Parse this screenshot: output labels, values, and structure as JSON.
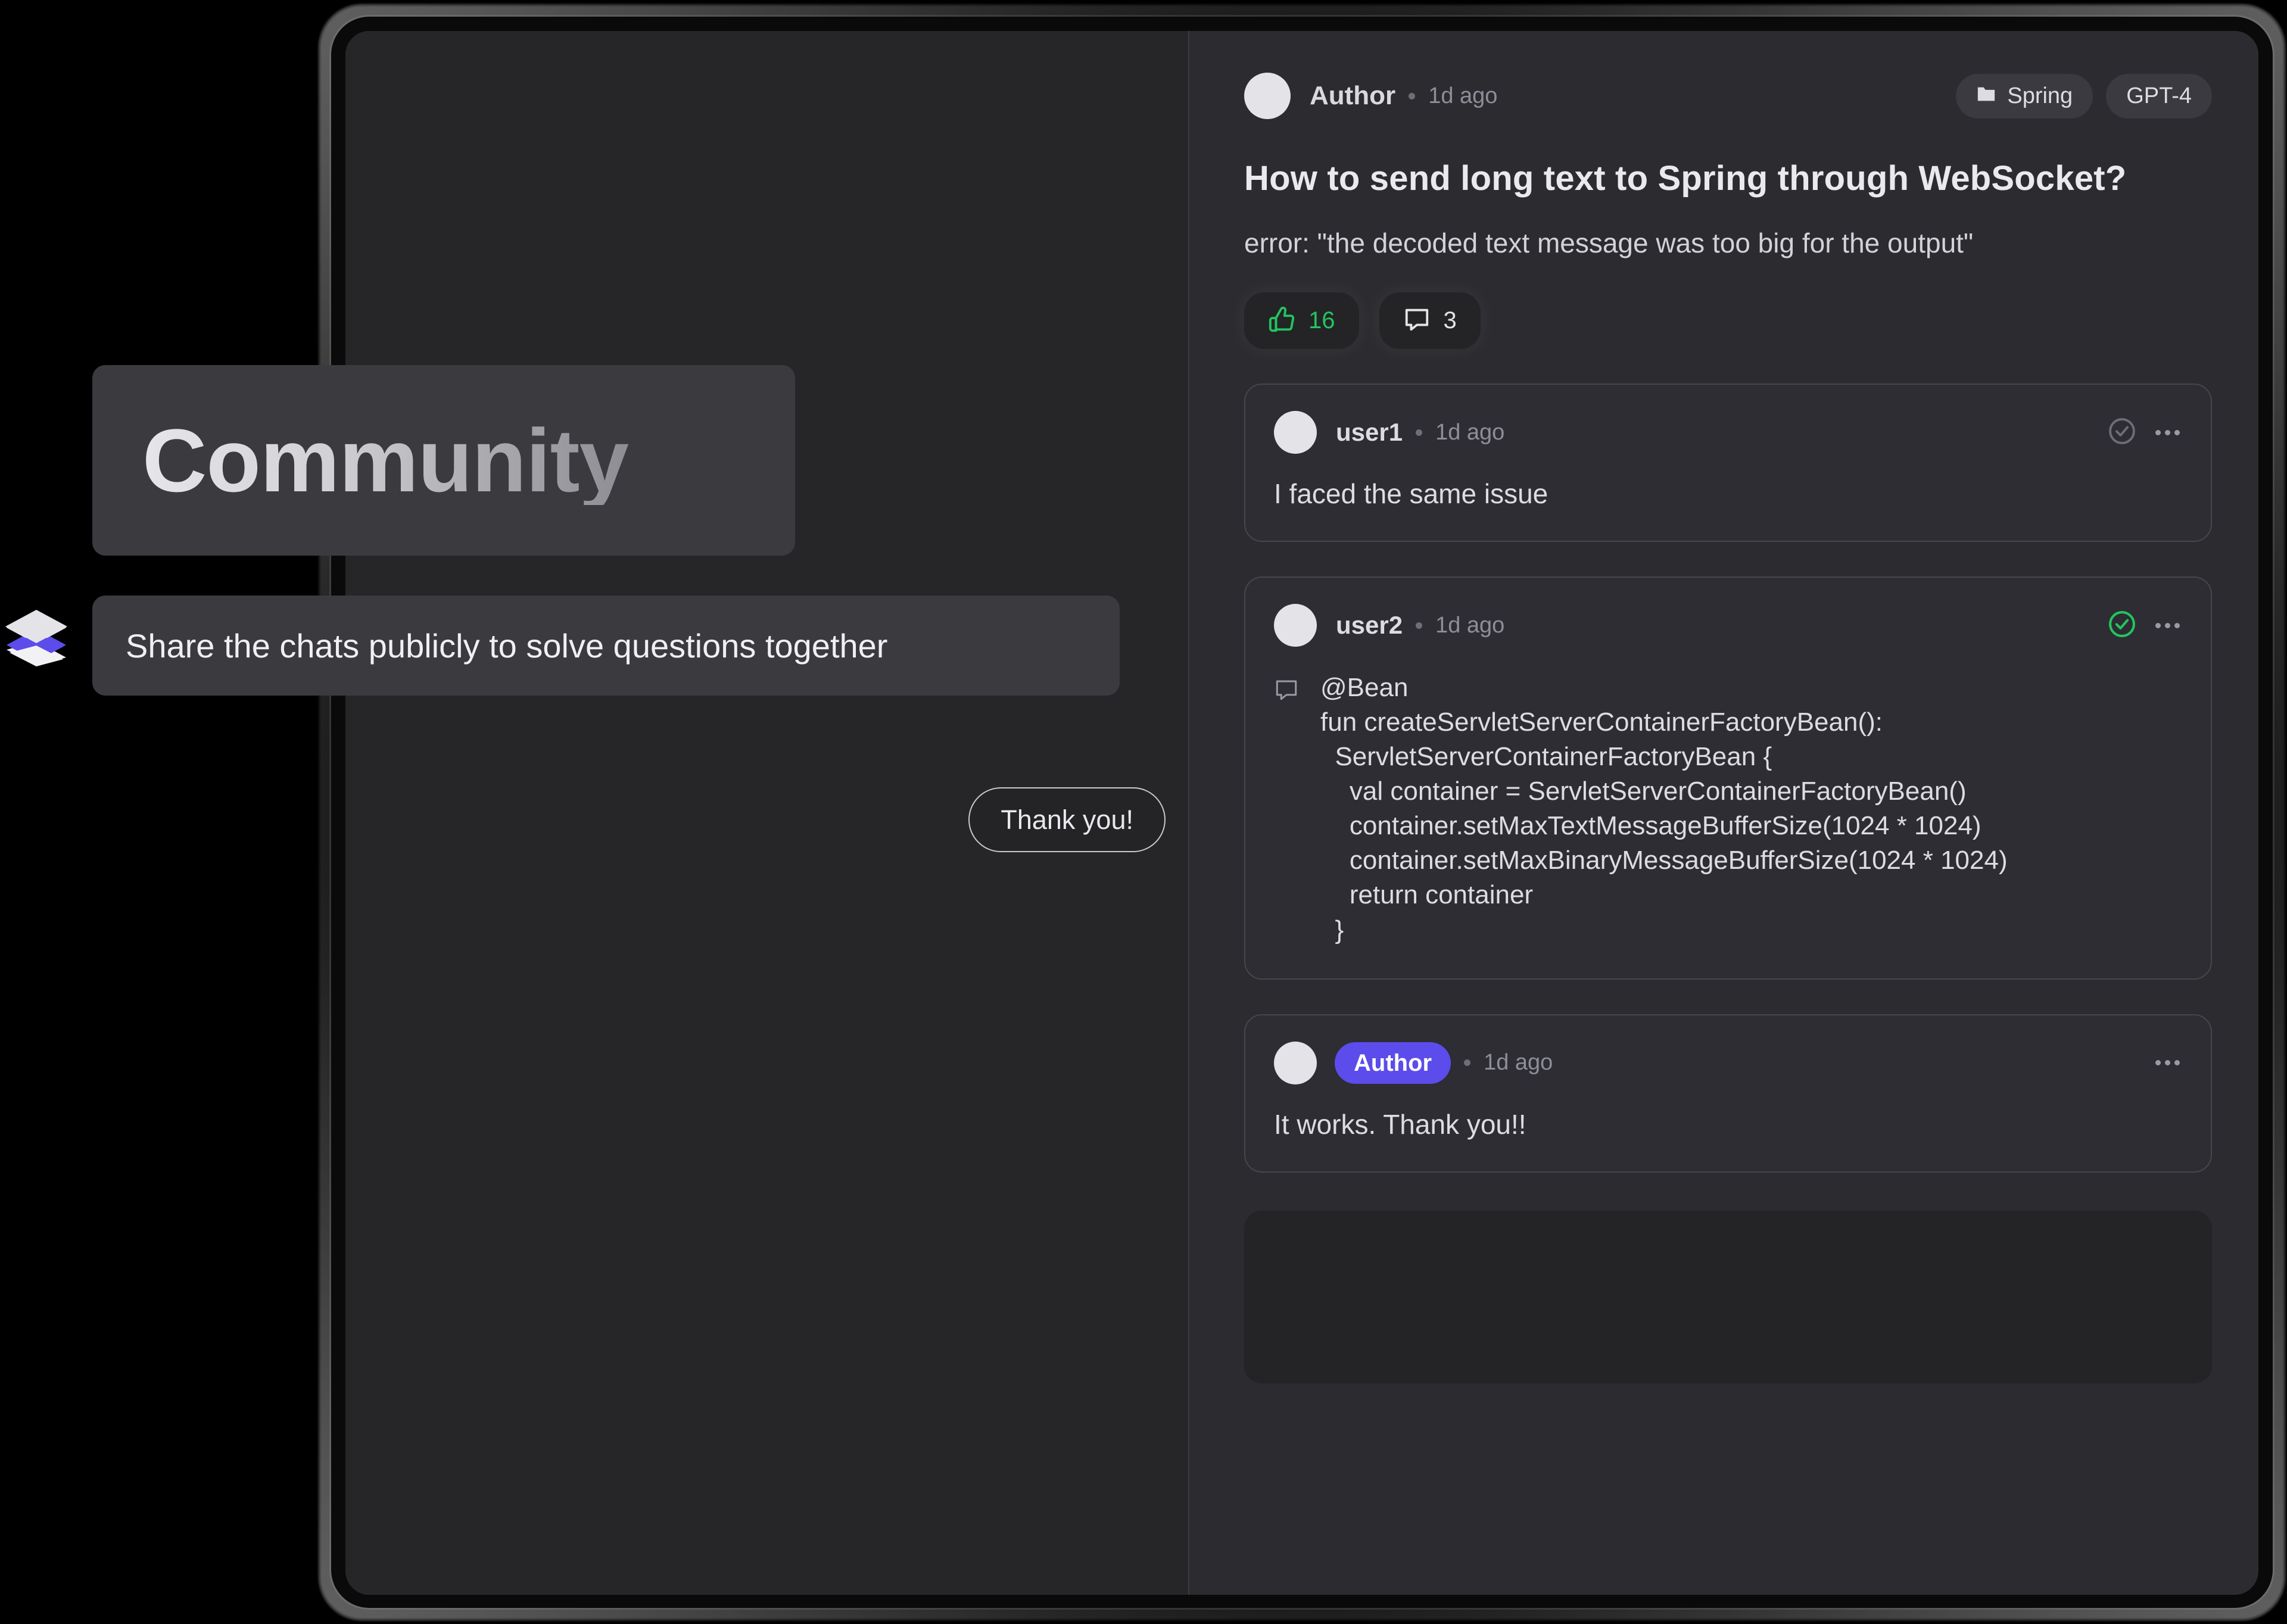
{
  "overlay": {
    "heading": "Community",
    "subtitle": "Share the chats publicly to solve questions together",
    "logo_icon": "layers-stack-icon"
  },
  "left_panel": {
    "outgoing_message": "Thank you!"
  },
  "post": {
    "avatar_icon": "avatar",
    "author": "Author",
    "timestamp": "1d ago",
    "tags": [
      {
        "label": "Spring",
        "icon": "folder-icon"
      },
      {
        "label": "GPT-4",
        "icon": ""
      }
    ],
    "title": "How to send long text to Spring through WebSocket?",
    "body": "error: \"the decoded text message was too big for the output\"",
    "reactions": {
      "like_icon": "thumbs-up-icon",
      "like_count": "16",
      "comment_icon": "comment-icon",
      "comment_count": "3"
    }
  },
  "comments": [
    {
      "avatar_icon": "avatar",
      "user": "user1",
      "timestamp": "1d ago",
      "accepted": false,
      "check_icon": "check-circle-icon",
      "menu_icon": "more-options-icon",
      "body": "I faced the same issue"
    },
    {
      "avatar_icon": "avatar",
      "user": "user2",
      "timestamp": "1d ago",
      "accepted": true,
      "check_icon": "check-circle-icon",
      "menu_icon": "more-options-icon",
      "bubble_icon": "comment-bubble-icon",
      "code": "@Bean\nfun createServletServerContainerFactoryBean():\n  ServletServerContainerFactoryBean {\n    val container = ServletServerContainerFactoryBean()\n    container.setMaxTextMessageBufferSize(1024 * 1024)\n    container.setMaxBinaryMessageBufferSize(1024 * 1024)\n    return container\n  }"
    },
    {
      "avatar_icon": "avatar",
      "badge": "Author",
      "timestamp": "1d ago",
      "menu_icon": "more-options-icon",
      "body": "It works. Thank you!!"
    }
  ],
  "colors": {
    "accent_author": "#5b4ceb",
    "accent_accepted": "#22c55e",
    "like_green": "#22c55e",
    "panel_left": "#262629",
    "panel_right": "#2b2b30",
    "overlay_card": "#3a3a3f"
  }
}
